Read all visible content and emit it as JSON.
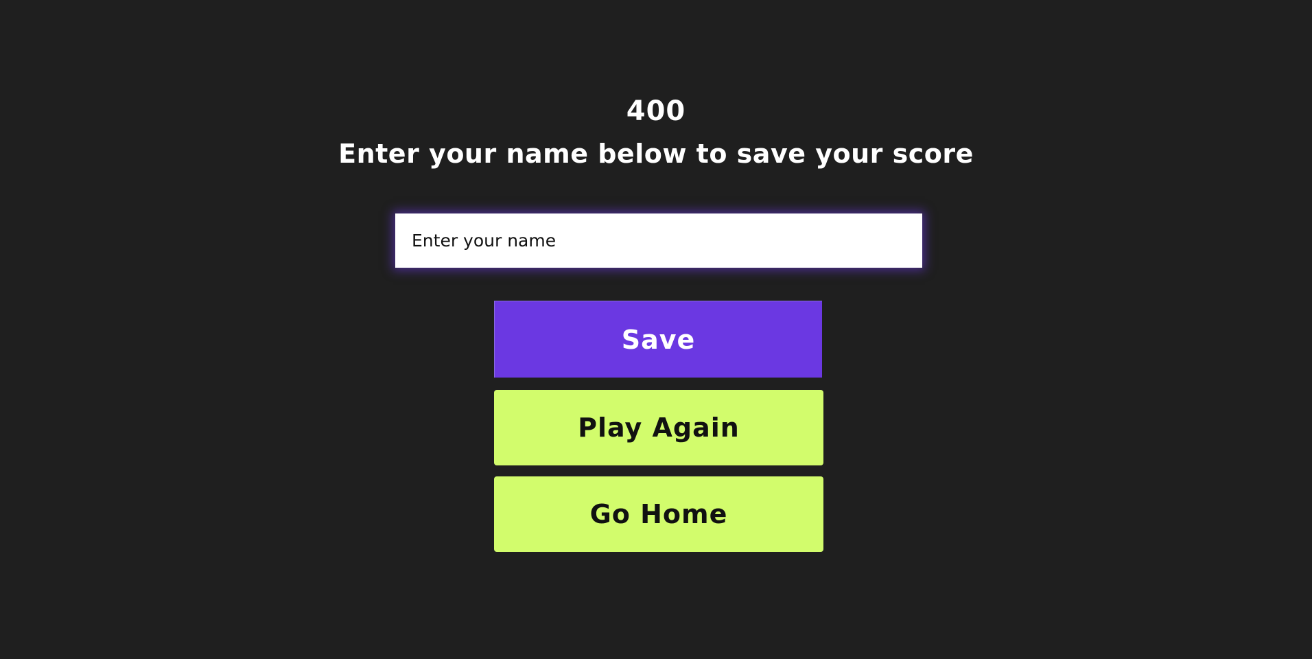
{
  "score": {
    "value": "400"
  },
  "prompt": {
    "text": "Enter your name below to save your score"
  },
  "name_input": {
    "placeholder": "Enter your name",
    "value": ""
  },
  "buttons": {
    "save_label": "Save",
    "play_again_label": "Play Again",
    "go_home_label": "Go Home"
  },
  "colors": {
    "background": "#1f1f1f",
    "accent_purple": "#6b38e2",
    "accent_lime": "#d2fc6c",
    "text_light": "#ffffff",
    "text_dark": "#111111"
  }
}
